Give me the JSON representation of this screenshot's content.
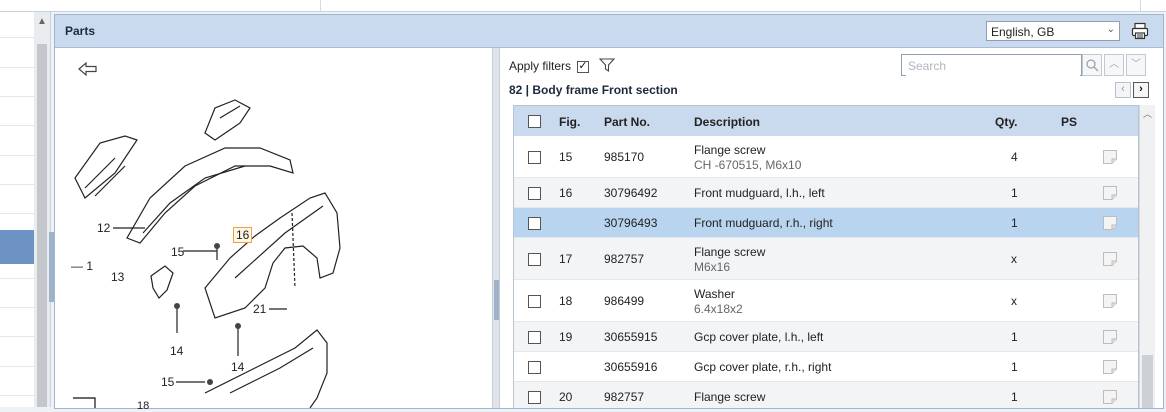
{
  "panel": {
    "title": "Parts"
  },
  "language": {
    "selected": "English, GB"
  },
  "filters": {
    "label": "Apply filters",
    "checked": true
  },
  "search": {
    "placeholder": "Search"
  },
  "section": {
    "title": "82  |  Body frame Front section"
  },
  "table": {
    "headers": {
      "fig": "Fig.",
      "part_no": "Part No.",
      "description": "Description",
      "qty": "Qty.",
      "ps": "PS"
    },
    "rows": [
      {
        "fig": "15",
        "part_no": "985170",
        "description": "Flange screw",
        "sub": "CH -670515, M6x10",
        "qty": "4",
        "selected": false
      },
      {
        "fig": "16",
        "part_no": "30796492",
        "description": "Front mudguard, l.h., left",
        "sub": "",
        "qty": "1",
        "selected": false
      },
      {
        "fig": "",
        "part_no": "30796493",
        "description": "Front mudguard, r.h., right",
        "sub": "",
        "qty": "1",
        "selected": true
      },
      {
        "fig": "17",
        "part_no": "982757",
        "description": "Flange screw",
        "sub": "M6x16",
        "qty": "x",
        "selected": false
      },
      {
        "fig": "18",
        "part_no": "986499",
        "description": "Washer",
        "sub": "6.4x18x2",
        "qty": "x",
        "selected": false
      },
      {
        "fig": "19",
        "part_no": "30655915",
        "description": "Gcp cover plate, l.h., left",
        "sub": "",
        "qty": "1",
        "selected": false
      },
      {
        "fig": "",
        "part_no": "30655916",
        "description": "Gcp cover plate, r.h., right",
        "sub": "",
        "qty": "1",
        "selected": false
      },
      {
        "fig": "20",
        "part_no": "982757",
        "description": "Flange screw",
        "sub": "",
        "qty": "1",
        "selected": false
      }
    ]
  },
  "diagram_labels": {
    "l12": "12",
    "l15a": "15",
    "l16": "16",
    "l1": "— 1",
    "l13": "13",
    "l21": "21",
    "l14a": "14",
    "l14b": "14",
    "l15b": "15",
    "l18": "18"
  }
}
